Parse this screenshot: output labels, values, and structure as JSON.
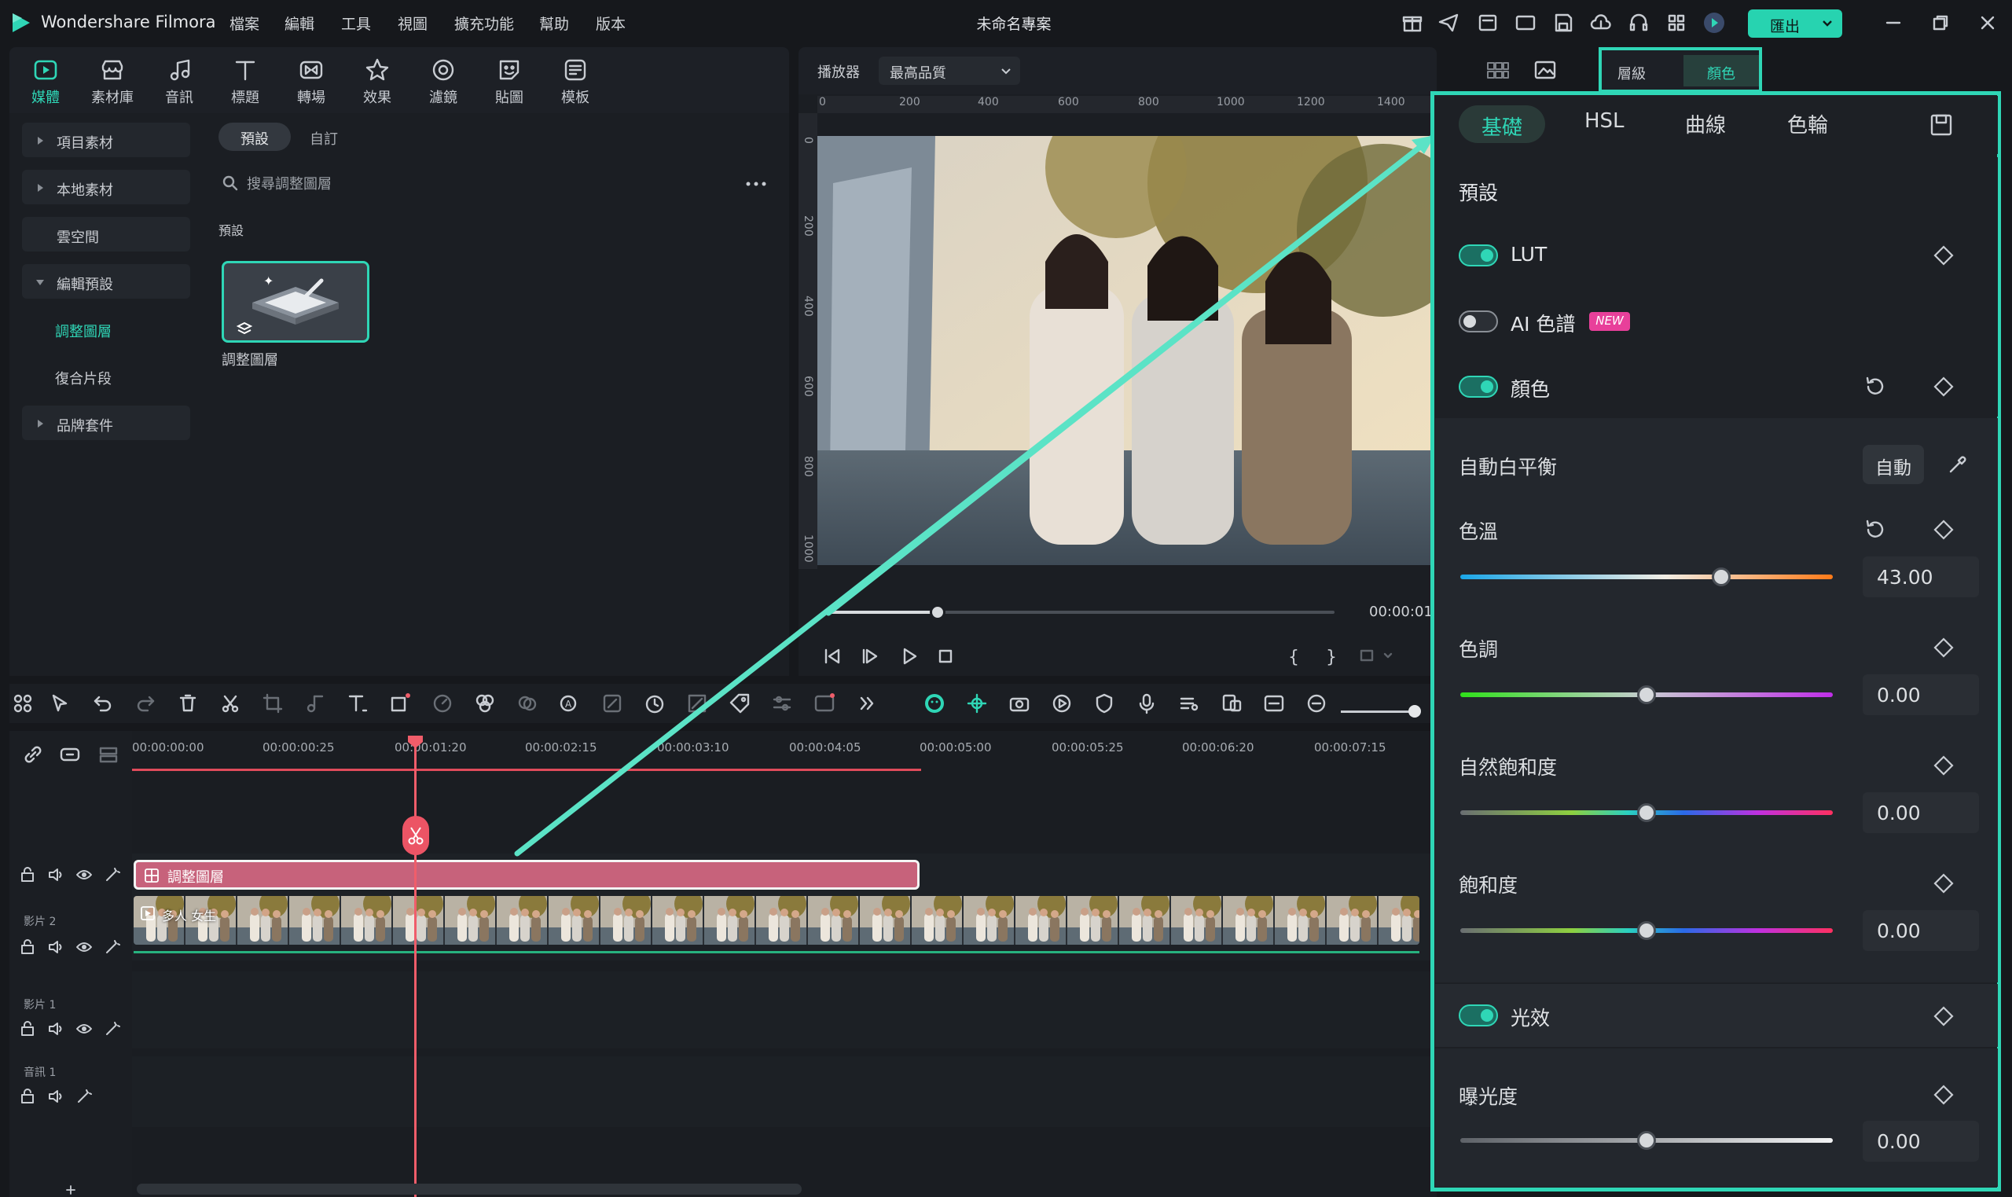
{
  "app": {
    "name": "Wondershare Filmora",
    "project_title": "未命名專案",
    "export_label": "匯出"
  },
  "menu": [
    "檔案",
    "編輯",
    "工具",
    "視圖",
    "擴充功能",
    "幫助",
    "版本"
  ],
  "media_tabs": [
    "媒體",
    "素材庫",
    "音訊",
    "標題",
    "轉場",
    "效果",
    "濾鏡",
    "貼圖",
    "模板"
  ],
  "sidebar": {
    "items": [
      "項目素材",
      "本地素材",
      "雲空間",
      "編輯預設",
      "品牌套件"
    ],
    "sub_items": [
      "調整圖層",
      "復合片段"
    ]
  },
  "content": {
    "tabs": [
      "預設",
      "自訂"
    ],
    "search_placeholder": "搜尋調整圖層",
    "section_label": "預設",
    "thumb_label": "調整圖層"
  },
  "player": {
    "label": "播放器",
    "quality": "最高品質",
    "time": "00:00:01:",
    "ruler_top": [
      "0",
      "200",
      "400",
      "600",
      "800",
      "1000",
      "1200",
      "1400"
    ],
    "ruler_left": [
      "0",
      "200",
      "400",
      "600",
      "800",
      "1000"
    ]
  },
  "timeline": {
    "timecodes": [
      "00:00:00:00",
      "00:00:00:25",
      "00:00:01:20",
      "00:00:02:15",
      "00:00:03:10",
      "00:00:04:05",
      "00:00:05:00",
      "00:00:05:25",
      "00:00:06:20",
      "00:00:07:15"
    ],
    "adj_clip_label": "調整圖層",
    "video_clip_label": "多人 女生",
    "tracks": [
      "影片 2",
      "影片 1",
      "音訊 1"
    ]
  },
  "panel": {
    "tabs": [
      "層級",
      "顏色"
    ],
    "sub_tabs": [
      "基礎",
      "HSL",
      "曲線",
      "色輪"
    ],
    "preset_label": "預設",
    "lut_label": "LUT",
    "ai_label": "AI 色譜",
    "new_badge": "NEW",
    "color_label": "顏色",
    "auto_wb_label": "自動白平衡",
    "auto_btn": "自動",
    "light_label": "光效",
    "properties": [
      {
        "label": "色溫",
        "value": "43.00",
        "fraction": 0.7
      },
      {
        "label": "色調",
        "value": "0.00",
        "fraction": 0.5
      },
      {
        "label": "自然飽和度",
        "value": "0.00",
        "fraction": 0.5
      },
      {
        "label": "飽和度",
        "value": "0.00",
        "fraction": 0.5
      },
      {
        "label": "曝光度",
        "value": "0.00",
        "fraction": 0.5
      }
    ]
  },
  "colors": {
    "accent": "#2fd6b6",
    "playhead": "#f05d6a",
    "adj_clip": "#c7627b"
  }
}
